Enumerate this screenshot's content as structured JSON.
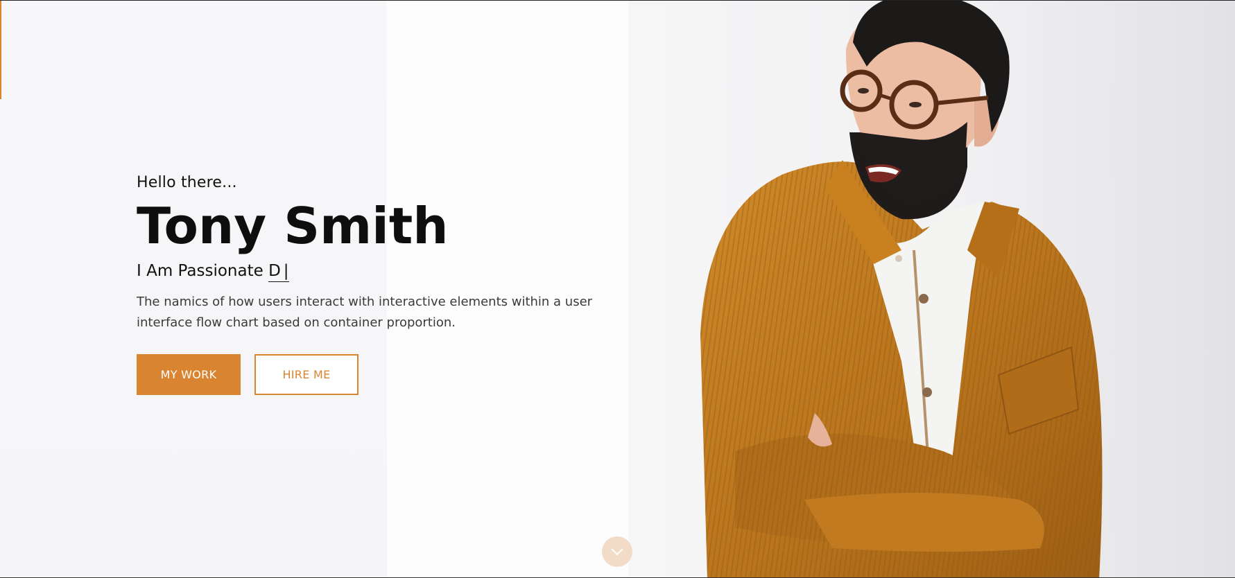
{
  "hero": {
    "greeting": "Hello there...",
    "name": "Tony Smith",
    "tagline_prefix": "I Am Passionate",
    "tagline_typed": "D",
    "tagline_cursor": "|",
    "description": "The namics of how users interact with interactive elements within a user interface flow chart based on container proportion."
  },
  "buttons": {
    "my_work": "MY WORK",
    "hire_me": "HIRE ME"
  },
  "icons": {
    "scroll": "chevron-down-icon"
  },
  "colors": {
    "accent": "#d98430",
    "accent_soft": "#f3dcc7",
    "text_dark": "#0e0e0e",
    "text_body": "#3a3a3a",
    "jacket": "#c07a1e",
    "hair": "#1c1a19"
  }
}
